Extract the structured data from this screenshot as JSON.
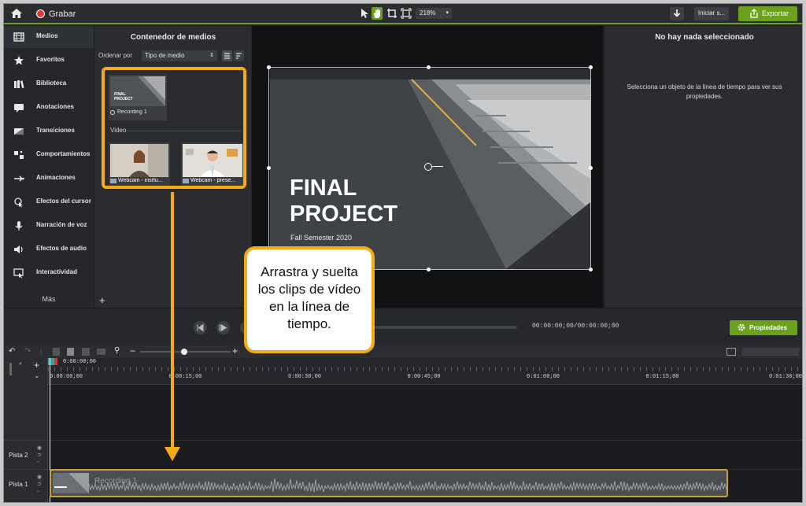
{
  "topbar": {
    "record_label": "Grabar",
    "zoom": "218%",
    "share_label": "Iniciar s...",
    "export_label": "Exportar"
  },
  "sidebar": {
    "items": [
      {
        "label": "Medios",
        "icon": "film-icon"
      },
      {
        "label": "Favoritos",
        "icon": "star-icon"
      },
      {
        "label": "Biblioteca",
        "icon": "library-icon"
      },
      {
        "label": "Anotaciones",
        "icon": "annotation-icon"
      },
      {
        "label": "Transiciones",
        "icon": "transition-icon"
      },
      {
        "label": "Comportamientos",
        "icon": "behavior-icon"
      },
      {
        "label": "Animaciones",
        "icon": "animation-icon"
      },
      {
        "label": "Efectos del cursor",
        "icon": "cursor-icon"
      },
      {
        "label": "Narración de voz",
        "icon": "microphone-icon"
      },
      {
        "label": "Efectos de audio",
        "icon": "speaker-icon"
      },
      {
        "label": "Interactividad",
        "icon": "interactive-icon"
      }
    ],
    "more_label": "Más"
  },
  "media_bin": {
    "title": "Contenedor de medios",
    "sort_label": "Ordenar por",
    "sort_value": "Tipo de medio",
    "items": {
      "recording": {
        "thumb_title": "FINAL PROJECT",
        "label": "Recording 1"
      },
      "section_video": "Video",
      "webcam1": "Webcam - insrtu...",
      "webcam2": "Webcam - prese..."
    }
  },
  "canvas": {
    "title_line1": "FINAL",
    "title_line2": "PROJECT",
    "subtitle": "Fall Semester 2020"
  },
  "properties_panel": {
    "title": "No hay nada seleccionado",
    "hint": "Selecciona un objeto de la línea de tiempo para ver sus propiedades.",
    "button_label": "Propiedades"
  },
  "player": {
    "timecode": "00:00:00;00/00:00:00;00"
  },
  "timeline": {
    "playhead_time": "0:00:00;00",
    "ticks": [
      "0:00:00;00",
      "0:00:15;00",
      "0:00:30;00",
      "0:00:45;00",
      "0:01:00;00",
      "0:01:15;00",
      "0:01:30;00"
    ],
    "tracks": [
      "Pista 2",
      "Pista 1"
    ],
    "clip_label": "Recording 1"
  },
  "callout": {
    "text": "Arrastra y suelta los clips de vídeo en la línea de tiempo."
  },
  "colors": {
    "accent_green": "#6ba11f",
    "callout_orange": "#f5ab16",
    "record_red": "#e53a3a"
  }
}
